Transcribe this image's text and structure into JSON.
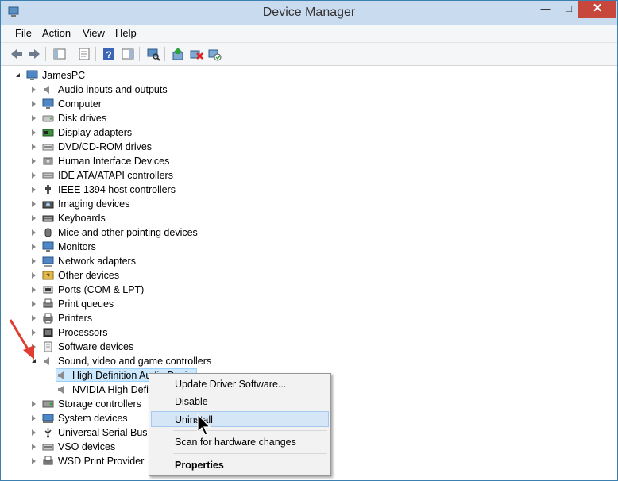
{
  "window": {
    "title": "Device Manager"
  },
  "menu": [
    "File",
    "Action",
    "View",
    "Help"
  ],
  "tree": {
    "root": "JamesPC",
    "categories": [
      {
        "label": "Audio inputs and outputs",
        "icon": "speaker-icon"
      },
      {
        "label": "Computer",
        "icon": "computer-icon"
      },
      {
        "label": "Disk drives",
        "icon": "disk-drive-icon"
      },
      {
        "label": "Display adapters",
        "icon": "display-adapter-icon"
      },
      {
        "label": "DVD/CD-ROM drives",
        "icon": "dvd-drive-icon"
      },
      {
        "label": "Human Interface Devices",
        "icon": "hid-icon"
      },
      {
        "label": "IDE ATA/ATAPI controllers",
        "icon": "ide-controller-icon"
      },
      {
        "label": "IEEE 1394 host controllers",
        "icon": "ieee1394-icon"
      },
      {
        "label": "Imaging devices",
        "icon": "camera-icon"
      },
      {
        "label": "Keyboards",
        "icon": "keyboard-icon"
      },
      {
        "label": "Mice and other pointing devices",
        "icon": "mouse-icon"
      },
      {
        "label": "Monitors",
        "icon": "monitor-icon"
      },
      {
        "label": "Network adapters",
        "icon": "network-icon"
      },
      {
        "label": "Other devices",
        "icon": "other-devices-icon"
      },
      {
        "label": "Ports (COM & LPT)",
        "icon": "port-icon"
      },
      {
        "label": "Print queues",
        "icon": "print-queue-icon"
      },
      {
        "label": "Printers",
        "icon": "printer-icon"
      },
      {
        "label": "Processors",
        "icon": "processor-icon"
      },
      {
        "label": "Software devices",
        "icon": "software-device-icon"
      },
      {
        "label": "Sound, video and game controllers",
        "icon": "speaker-icon",
        "expanded": true
      },
      {
        "label": "Storage controllers",
        "icon": "storage-icon"
      },
      {
        "label": "System devices",
        "icon": "system-icon"
      },
      {
        "label": "Universal Serial Bus c",
        "icon": "usb-icon"
      },
      {
        "label": "VSO devices",
        "icon": "vso-icon"
      },
      {
        "label": "WSD Print Provider",
        "icon": "wsd-icon"
      }
    ],
    "children": [
      "High Definition Audio Devi",
      "NVIDIA High Defi"
    ]
  },
  "context_menu": {
    "items": [
      "Update Driver Software...",
      "Disable",
      "Uninstall",
      "Scan for hardware changes",
      "Properties"
    ],
    "highlighted": "Uninstall"
  },
  "colors": {
    "accent": "#3c7fb1",
    "selection": "#cce8ff",
    "close": "#c7473c"
  }
}
